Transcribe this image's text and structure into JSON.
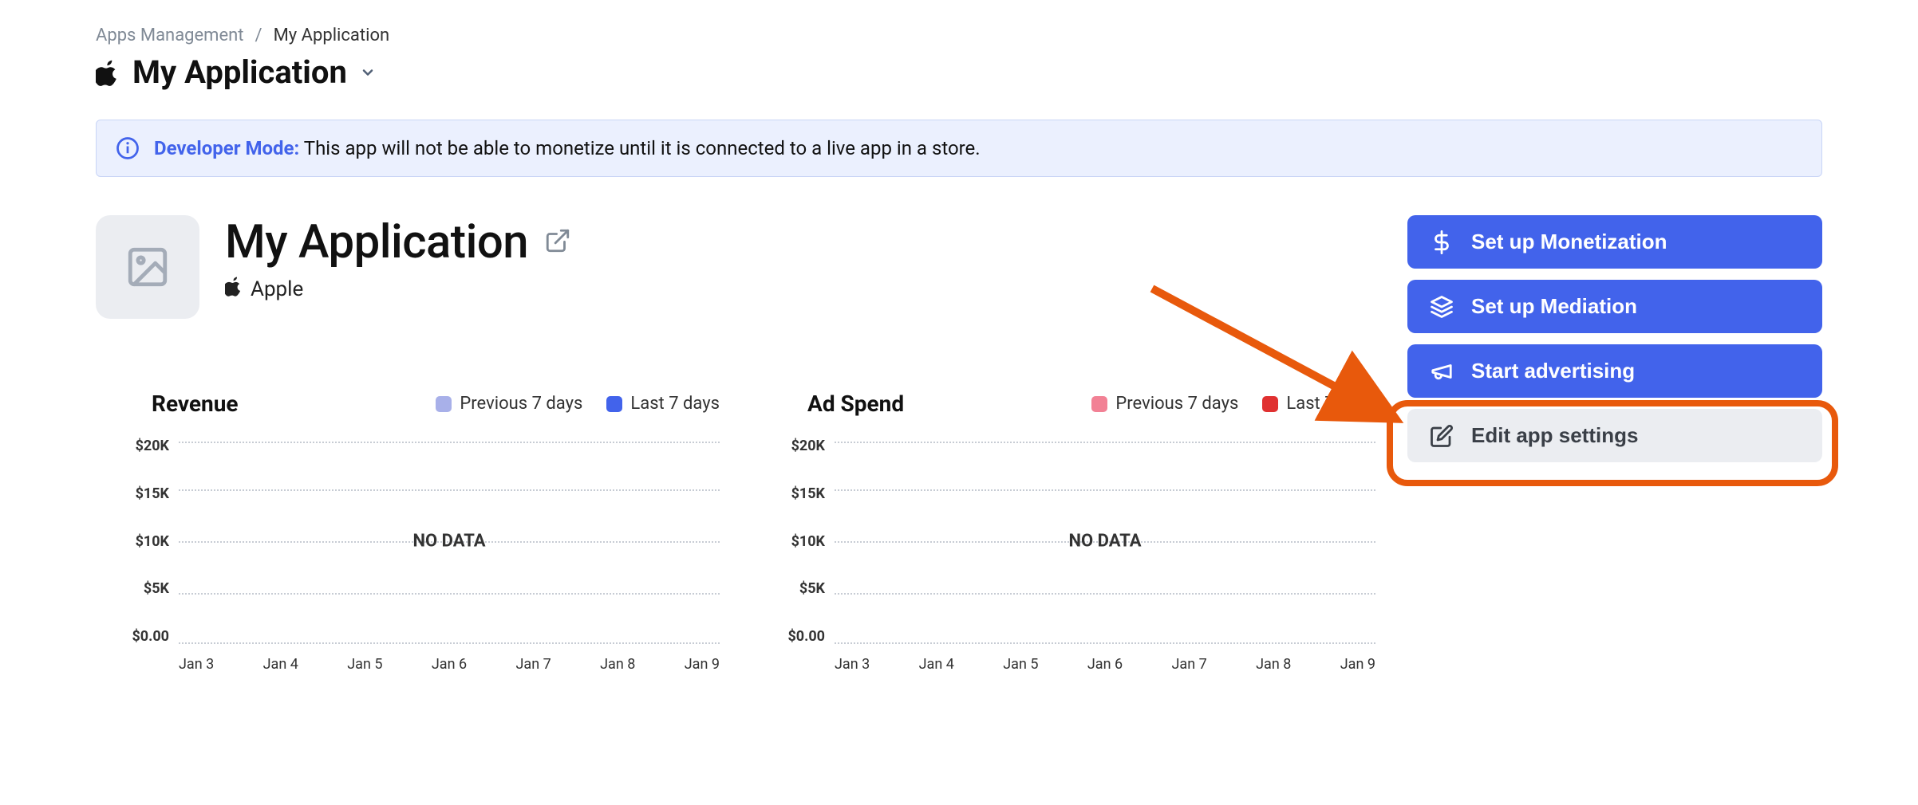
{
  "breadcrumb": {
    "parent": "Apps Management",
    "current": "My Application"
  },
  "page_title": "My Application",
  "banner": {
    "strong": "Developer Mode:",
    "text": "This app will not be able to monetize until it is connected to a live app in a store."
  },
  "app": {
    "title": "My Application",
    "platform": "Apple"
  },
  "actions": {
    "monetization": "Set up Monetization",
    "mediation": "Set up Mediation",
    "advertising": "Start advertising",
    "settings": "Edit app settings"
  },
  "chart_legend": {
    "prev": "Previous 7 days",
    "last": "Last 7 days"
  },
  "chart_titles": {
    "revenue": "Revenue",
    "adspend": "Ad Spend"
  },
  "no_data": "NO DATA",
  "chart_data": [
    {
      "type": "line",
      "title": "Revenue",
      "xlabel": "",
      "ylabel": "",
      "ylim": [
        0,
        20000
      ],
      "y_ticks": [
        "$20K",
        "$15K",
        "$10K",
        "$5K",
        "$0.00"
      ],
      "categories": [
        "Jan 3",
        "Jan 4",
        "Jan 5",
        "Jan 6",
        "Jan 7",
        "Jan 8",
        "Jan 9"
      ],
      "series": [
        {
          "name": "Previous 7 days",
          "color": "#a8b0e9",
          "values": []
        },
        {
          "name": "Last 7 days",
          "color": "#4263eb",
          "values": []
        }
      ],
      "empty": true
    },
    {
      "type": "line",
      "title": "Ad Spend",
      "xlabel": "",
      "ylabel": "",
      "ylim": [
        0,
        20000
      ],
      "y_ticks": [
        "$20K",
        "$15K",
        "$10K",
        "$5K",
        "$0.00"
      ],
      "categories": [
        "Jan 3",
        "Jan 4",
        "Jan 5",
        "Jan 6",
        "Jan 7",
        "Jan 8",
        "Jan 9"
      ],
      "series": [
        {
          "name": "Previous 7 days",
          "color": "#f28195",
          "values": []
        },
        {
          "name": "Last 7 days",
          "color": "#e03131",
          "values": []
        }
      ],
      "empty": true
    }
  ]
}
